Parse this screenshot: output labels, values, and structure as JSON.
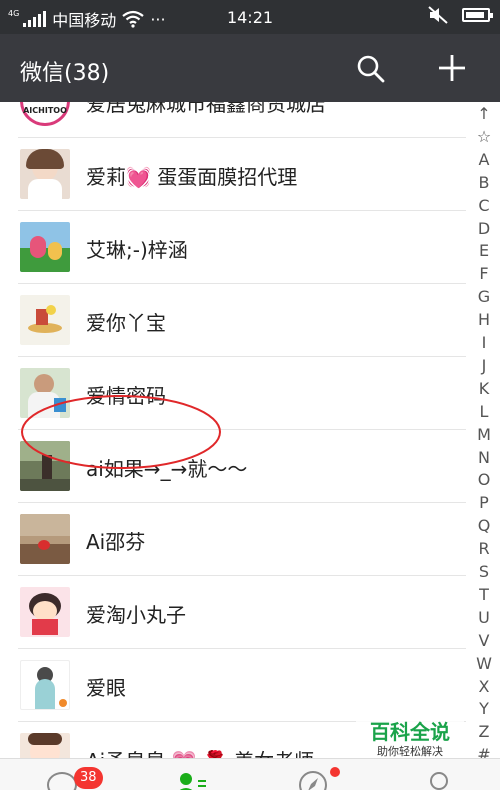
{
  "status_bar": {
    "network": "4G",
    "carrier": "中国移动",
    "more": "···",
    "time": "14:21"
  },
  "header": {
    "title": "微信(38)"
  },
  "contacts": [
    {
      "name": "爱居兔麻城市福鑫商贸城店",
      "avatar_text": "AICHITOO"
    },
    {
      "name": "爱莉💓 蛋蛋面膜招代理"
    },
    {
      "name": "艾琳;-)梓涵"
    },
    {
      "name": "爱你丫宝"
    },
    {
      "name": "爱情密码"
    },
    {
      "name": "ai如果→_→就～～"
    },
    {
      "name": "Ai邵芬"
    },
    {
      "name": "爱淘小丸子"
    },
    {
      "name": "爱眼"
    },
    {
      "name": "Ai予皂皂 💗 🌹 姜女老师"
    }
  ],
  "index_letters": [
    "↑",
    "☆",
    "A",
    "B",
    "C",
    "D",
    "E",
    "F",
    "G",
    "H",
    "I",
    "J",
    "K",
    "L",
    "M",
    "N",
    "O",
    "P",
    "Q",
    "R",
    "S",
    "T",
    "U",
    "V",
    "W",
    "X",
    "Y",
    "Z",
    "#"
  ],
  "bottom_nav": {
    "chats_badge": "38"
  },
  "watermark": {
    "title": "百科全说",
    "subtitle": "助你轻松解决"
  },
  "colors": {
    "status_bar_bg": "#2f3134",
    "title_bar_bg": "#393a3f",
    "accent_green": "#1aad19",
    "badge_red": "#f43530",
    "highlight_circle": "#e0282a"
  },
  "icons": {
    "search": "search-icon",
    "add": "plus-icon",
    "chats": "chat-bubble-icon",
    "contacts": "contacts-icon",
    "discover": "compass-icon",
    "me": "person-icon"
  }
}
